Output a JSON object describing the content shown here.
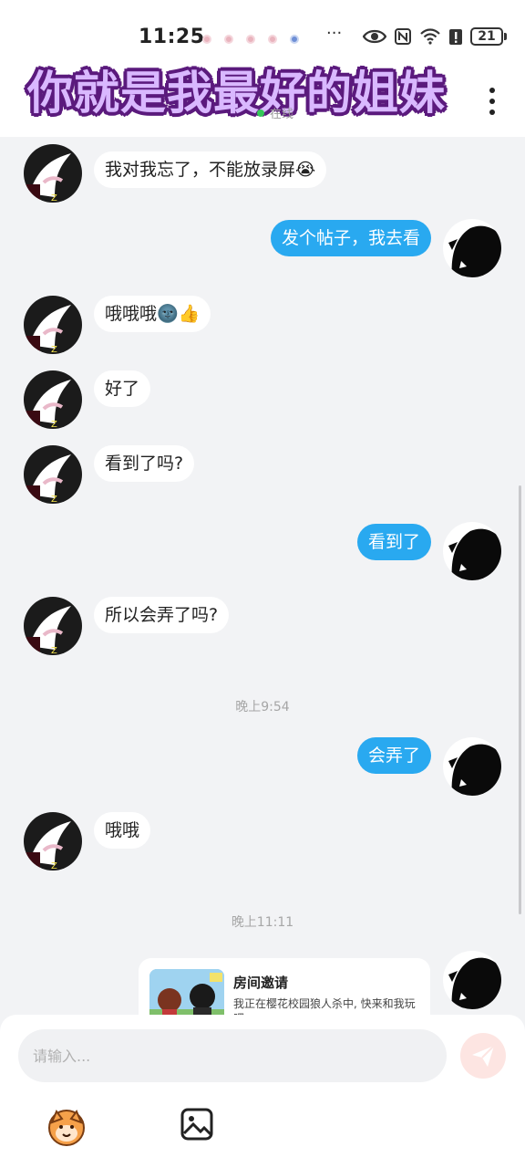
{
  "status_bar": {
    "time": "11:25",
    "more": "···",
    "battery": "21"
  },
  "header": {
    "overlay_title": "你就是我最好的姐妹",
    "online_status": "在线"
  },
  "messages": [
    {
      "side": "left",
      "text": "我对我忘了，不能放录屏😭"
    },
    {
      "side": "right",
      "text": "发个帖子，我去看"
    },
    {
      "side": "left",
      "text": "哦哦哦🌚👍"
    },
    {
      "side": "left",
      "text": "好了"
    },
    {
      "side": "left",
      "text": "看到了吗?"
    },
    {
      "side": "right",
      "text": "看到了"
    },
    {
      "side": "left",
      "text": "所以会弄了吗?"
    },
    {
      "side": "right",
      "text": "会弄了"
    },
    {
      "side": "left",
      "text": "哦哦"
    }
  ],
  "timestamps": [
    "晚上9:54",
    "晚上11:11"
  ],
  "invite_card": {
    "title": "房间邀请",
    "description": "我正在樱花校园狼人杀中, 快来和我玩吧"
  },
  "input": {
    "placeholder": "请输入..."
  },
  "icons": {
    "send": "send-icon",
    "emoji": "emoji-icon",
    "image": "image-icon",
    "more": "more-vertical-icon"
  },
  "colors": {
    "own_bubble": "#29a9f0",
    "other_bubble": "#ffffff",
    "background": "#f2f3f5",
    "send_button": "#fde5e2",
    "overlay_fill": "#d9b8ff",
    "overlay_outline": "#5b1a7d"
  }
}
